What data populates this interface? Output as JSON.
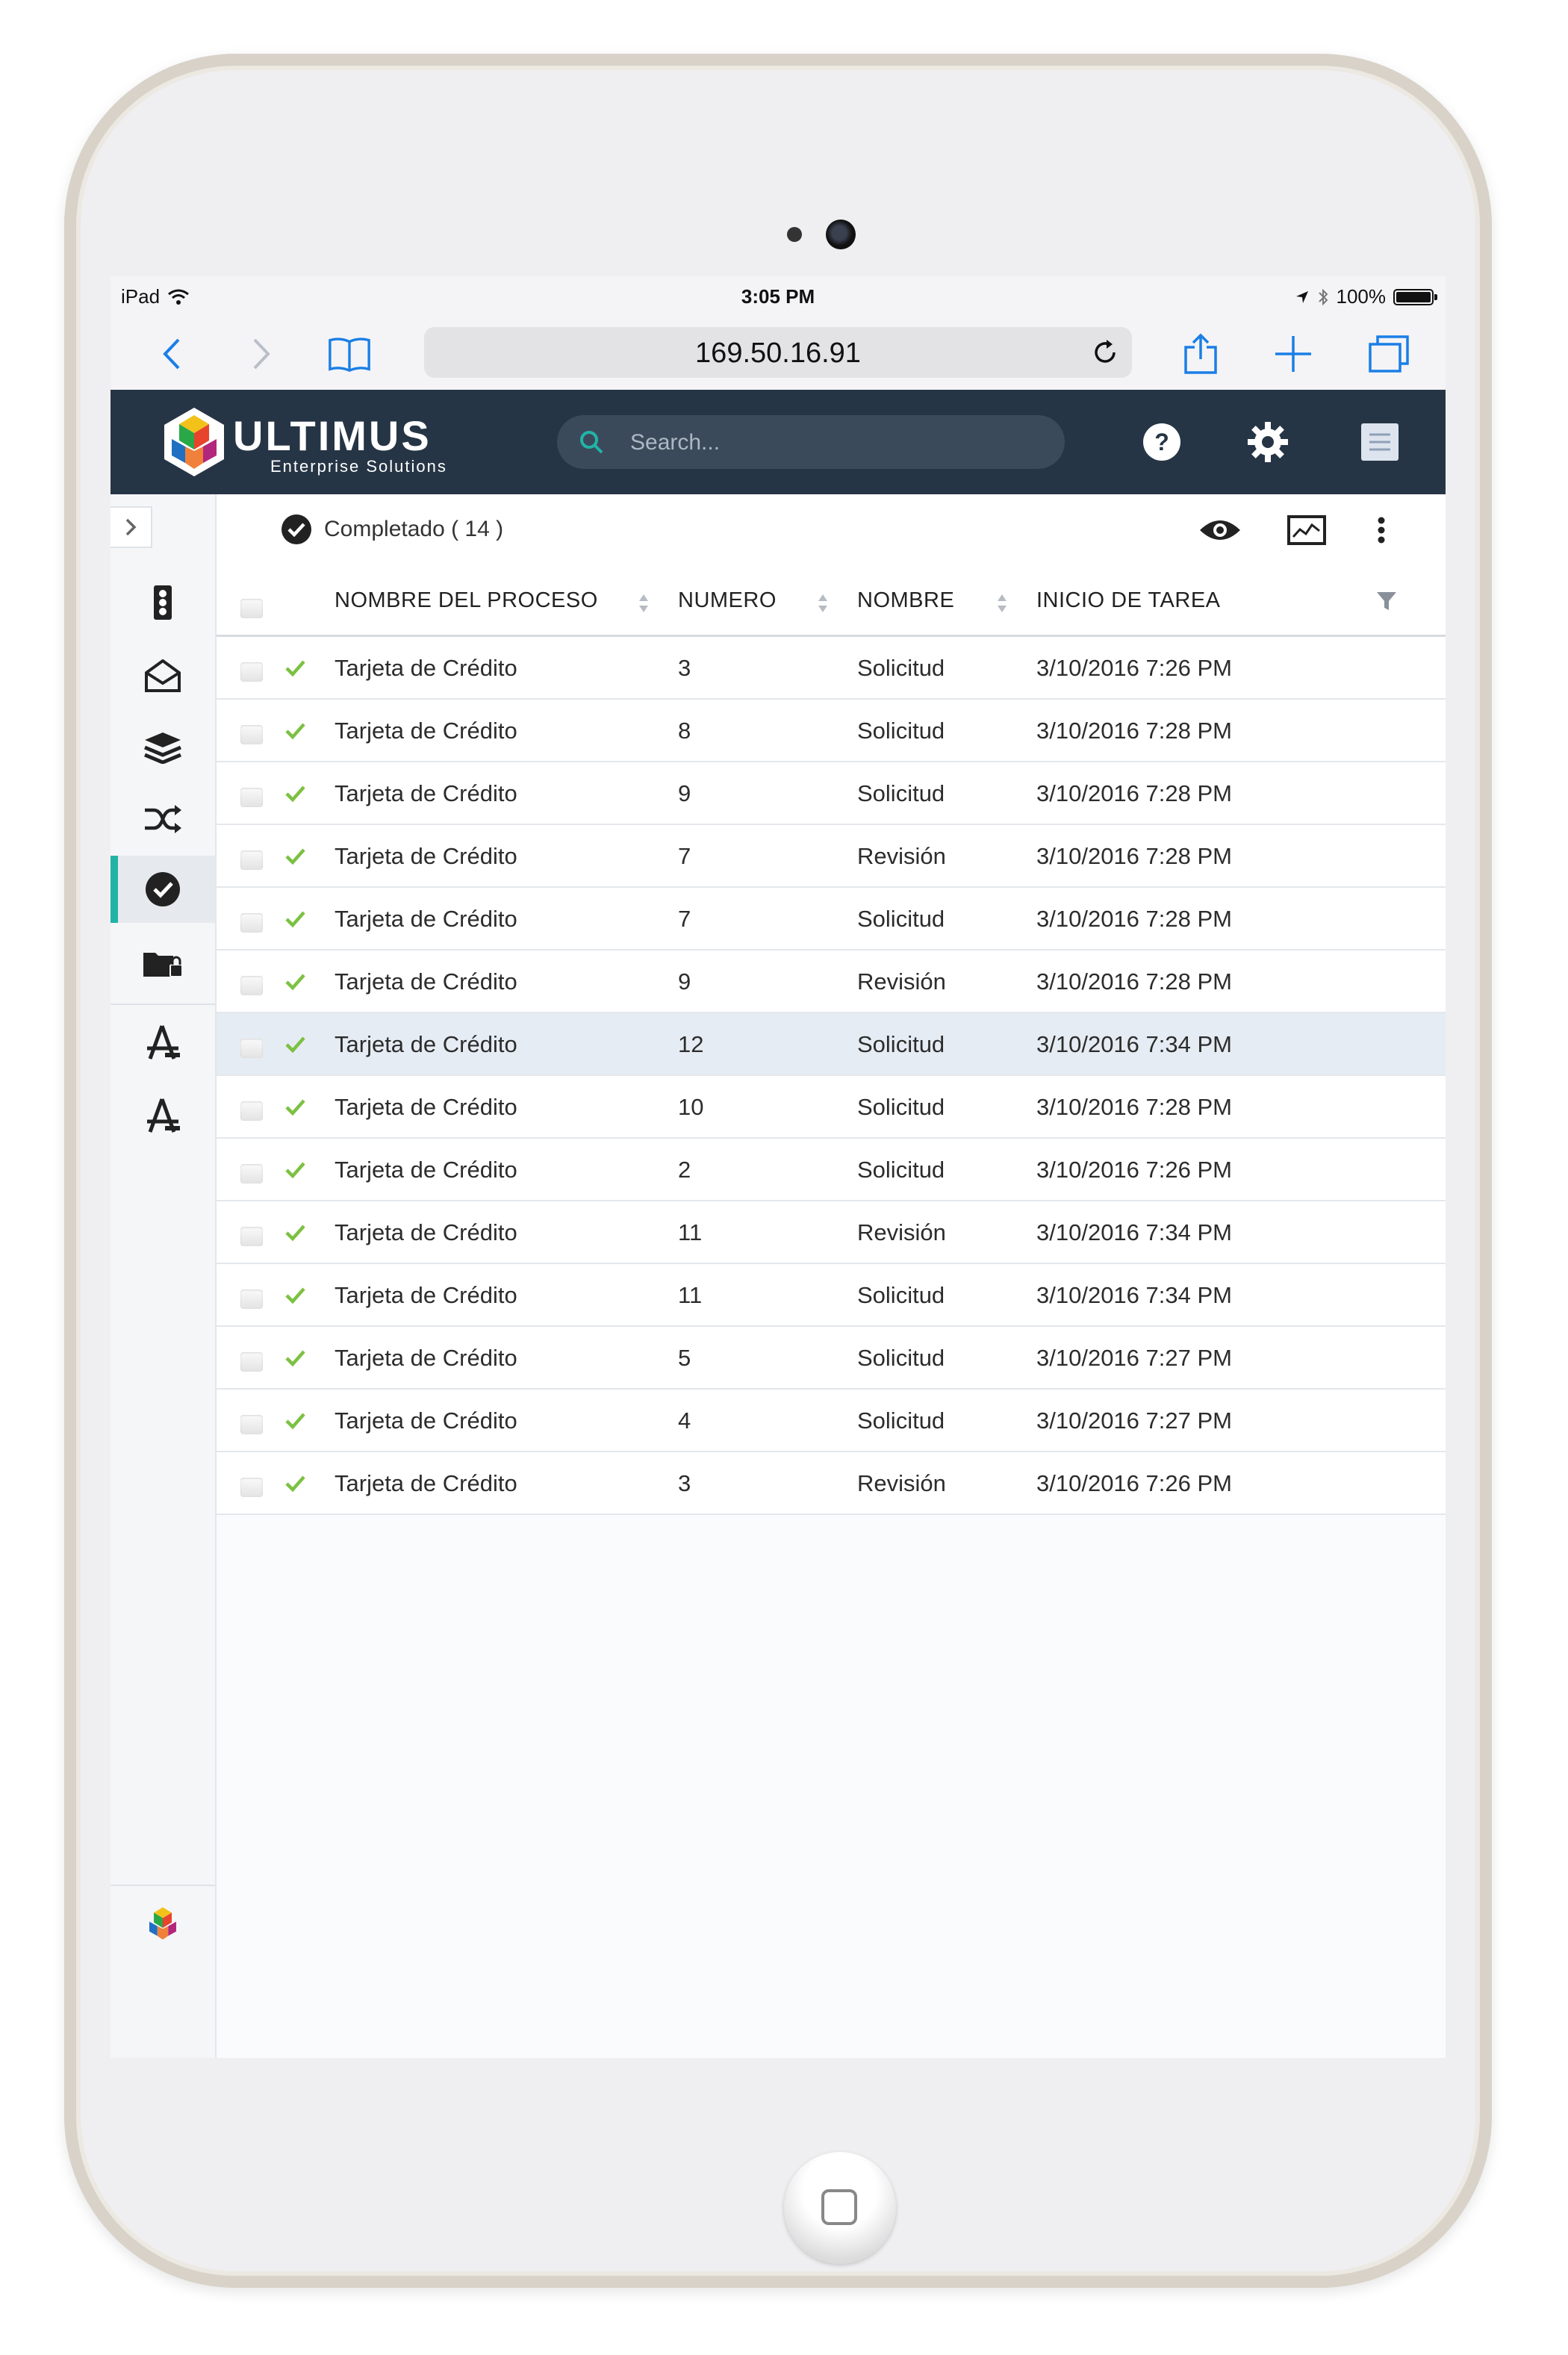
{
  "status_bar": {
    "device": "iPad",
    "time": "3:05 PM",
    "battery": "100%",
    "battery_level": 1.0
  },
  "browser": {
    "url": "169.50.16.91"
  },
  "app": {
    "brand": "ULTIMUS",
    "brand_subtitle": "Enterprise Solutions",
    "search_placeholder": "Search..."
  },
  "toolbar": {
    "status_label": "Completado ( 14 )"
  },
  "table": {
    "columns": [
      "NOMBRE DEL PROCESO",
      "NUMERO",
      "NOMBRE",
      "INICIO DE TAREA"
    ],
    "rows": [
      {
        "process": "Tarjeta de Crédito",
        "number": "3",
        "name": "Solicitud",
        "start": "3/10/2016 7:26 PM"
      },
      {
        "process": "Tarjeta de Crédito",
        "number": "8",
        "name": "Solicitud",
        "start": "3/10/2016 7:28 PM"
      },
      {
        "process": "Tarjeta de Crédito",
        "number": "9",
        "name": "Solicitud",
        "start": "3/10/2016 7:28 PM"
      },
      {
        "process": "Tarjeta de Crédito",
        "number": "7",
        "name": "Revisión",
        "start": "3/10/2016 7:28 PM"
      },
      {
        "process": "Tarjeta de Crédito",
        "number": "7",
        "name": "Solicitud",
        "start": "3/10/2016 7:28 PM"
      },
      {
        "process": "Tarjeta de Crédito",
        "number": "9",
        "name": "Revisión",
        "start": "3/10/2016 7:28 PM"
      },
      {
        "process": "Tarjeta de Crédito",
        "number": "12",
        "name": "Solicitud",
        "start": "3/10/2016 7:34 PM",
        "highlighted": true
      },
      {
        "process": "Tarjeta de Crédito",
        "number": "10",
        "name": "Solicitud",
        "start": "3/10/2016 7:28 PM"
      },
      {
        "process": "Tarjeta de Crédito",
        "number": "2",
        "name": "Solicitud",
        "start": "3/10/2016 7:26 PM"
      },
      {
        "process": "Tarjeta de Crédito",
        "number": "11",
        "name": "Revisión",
        "start": "3/10/2016 7:34 PM"
      },
      {
        "process": "Tarjeta de Crédito",
        "number": "11",
        "name": "Solicitud",
        "start": "3/10/2016 7:34 PM"
      },
      {
        "process": "Tarjeta de Crédito",
        "number": "5",
        "name": "Solicitud",
        "start": "3/10/2016 7:27 PM"
      },
      {
        "process": "Tarjeta de Crédito",
        "number": "4",
        "name": "Solicitud",
        "start": "3/10/2016 7:27 PM"
      },
      {
        "process": "Tarjeta de Crédito",
        "number": "3",
        "name": "Revisión",
        "start": "3/10/2016 7:26 PM"
      }
    ]
  },
  "sidebar": {
    "icons": [
      "traffic-light-icon",
      "inbox-icon",
      "layers-icon",
      "shuffle-icon",
      "check-circle-icon",
      "locked-folder-icon",
      "app-store-icon",
      "app-store-icon"
    ],
    "active_index": 4
  },
  "colors": {
    "header": "#263545",
    "accent": "#23b3a6",
    "check": "#7cc142",
    "safari_blue": "#1a7ee6"
  }
}
